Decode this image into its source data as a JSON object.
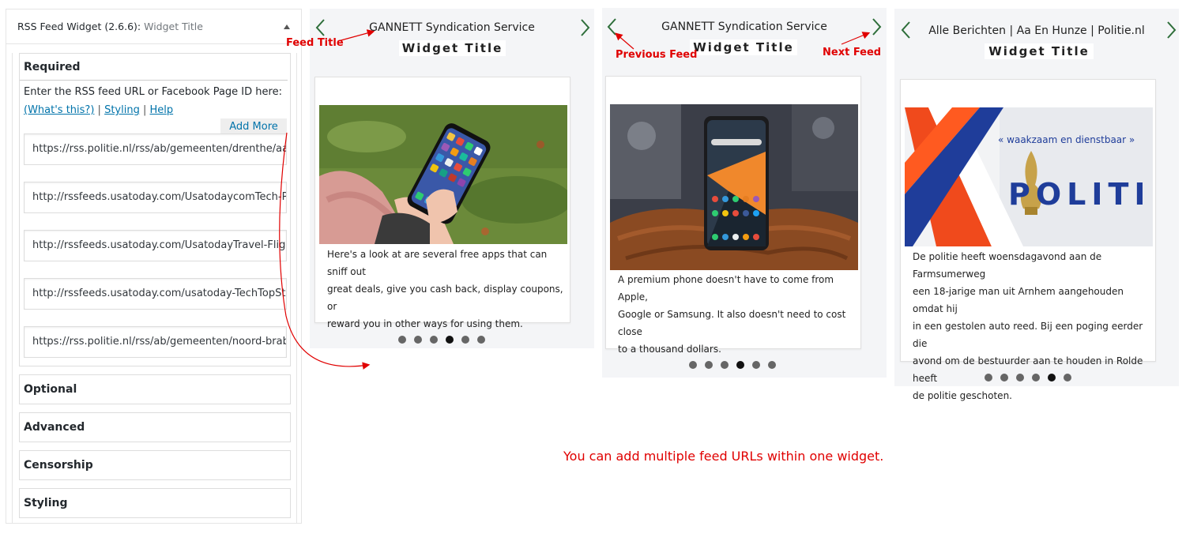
{
  "admin": {
    "title": "RSS Feed Widget",
    "version_label": "(2.6.6):",
    "widget_title": "Widget Title",
    "required": {
      "title": "Required",
      "description": "Enter the RSS feed URL or Facebook Page ID here:",
      "whats_this": "(What's this?)",
      "styling_link": "Styling",
      "help_link": "Help",
      "separator": "|",
      "add_more": "Add More",
      "feed_urls": [
        "https://rss.politie.nl/rss/ab/gemeenten/drenthe/aa-",
        "http://rssfeeds.usatoday.com/UsatodaycomTech-Pe",
        "http://rssfeeds.usatoday.com/UsatodayTravel-Fligh",
        "http://rssfeeds.usatoday.com/usatoday-TechTopSto",
        "https://rss.politie.nl/rss/ab/gemeenten/noord-braba"
      ]
    },
    "sections": [
      "Optional",
      "Advanced",
      "Censorship",
      "Styling"
    ]
  },
  "widgets": [
    {
      "feed_title": "GANNETT Syndication Service",
      "heading": "Widget Title",
      "text": [
        "Here's a look at are several free apps that can sniff out",
        "great deals, give you cash back, display coupons, or",
        "reward you in other ways for using them."
      ],
      "image": "phone-in-hand-photo",
      "dots": 6,
      "active_dot": 4
    },
    {
      "feed_title": "GANNETT Syndication Service",
      "heading": "Widget Title",
      "text": [
        "A premium phone doesn't have to come from Apple,",
        "Google or Samsung. It also doesn't need to cost close",
        "to a thousand dollars."
      ],
      "image": "smartphone-on-cushion-photo",
      "dots": 6,
      "active_dot": 4
    },
    {
      "feed_title": "Alle Berichten | Aa En Hunze | Politie.nl",
      "heading": "Widget Title",
      "text": [
        "De politie heeft woensdagavond aan de Farmsumerweg",
        "een 18-jarige man uit Arnhem aangehouden omdat hij",
        "in een gestolen auto reed. Bij een poging eerder die",
        "avond om de bestuurder aan te houden in Rolde heeft",
        "de politie geschoten."
      ],
      "image": "politie-car-photo",
      "image_text_top": "« waakzaam en dienstbaar »",
      "image_text_main": "POLITIE",
      "dots": 6,
      "active_dot": 5
    }
  ],
  "annotations": {
    "feed_title": "Feed Title",
    "previous_feed": "Previous Feed",
    "next_feed": "Next Feed",
    "footnote": "You can add multiple feed URLs within one widget."
  },
  "colors": {
    "annotation_red": "#e00000",
    "arrow_green": "#2e6e3a",
    "link_blue": "#0073aa",
    "widget_bg": "#f4f5f7"
  }
}
